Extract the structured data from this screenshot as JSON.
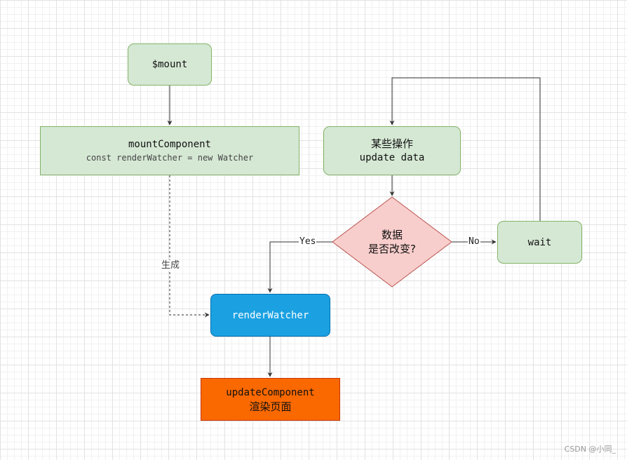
{
  "nodes": {
    "mount": "$mount",
    "mount_component": {
      "title": "mountComponent",
      "code": "const renderWatcher = new Watcher"
    },
    "update_data": {
      "line1": "某些操作",
      "line2": "update data"
    },
    "decision": {
      "line1": "数据",
      "line2": "是否改变?"
    },
    "wait": "wait",
    "render_watcher": "renderWatcher",
    "update_component": {
      "line1": "updateComponent",
      "line2": "渲染页面"
    }
  },
  "edge_labels": {
    "generate": "生成",
    "yes": "Yes",
    "no": "No"
  },
  "colors": {
    "green_fill": "#d5e8d4",
    "green_stroke": "#82b366",
    "red_fill": "#f8cecc",
    "red_stroke": "#b85450",
    "blue_fill": "#1ba1e2",
    "orange_fill": "#fa6800"
  },
  "watermark": "CSDN @小同_"
}
